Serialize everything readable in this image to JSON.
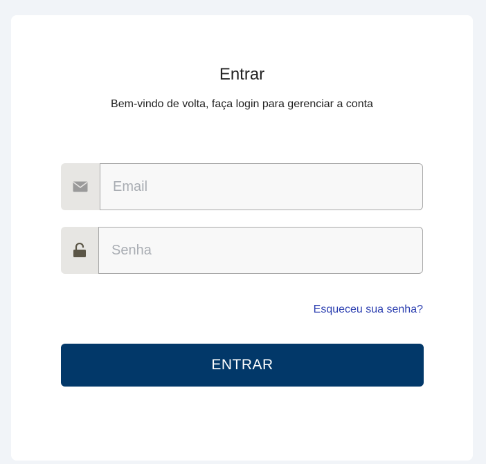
{
  "header": {
    "title": "Entrar",
    "subtitle": "Bem-vindo de volta, faça login para gerenciar a conta"
  },
  "form": {
    "email": {
      "value": "",
      "placeholder": "Email",
      "icon": "envelope-icon"
    },
    "password": {
      "value": "",
      "placeholder": "Senha",
      "icon": "unlocked-padlock-icon"
    },
    "forgot_link": "Esqueceu sua senha?",
    "submit_label": "ENTRAR"
  },
  "colors": {
    "background": "#f1f4f8",
    "card": "#ffffff",
    "addon": "#e7e6e3",
    "link": "#2c3fb0",
    "button": "#023869",
    "button_text": "#ffffff"
  }
}
